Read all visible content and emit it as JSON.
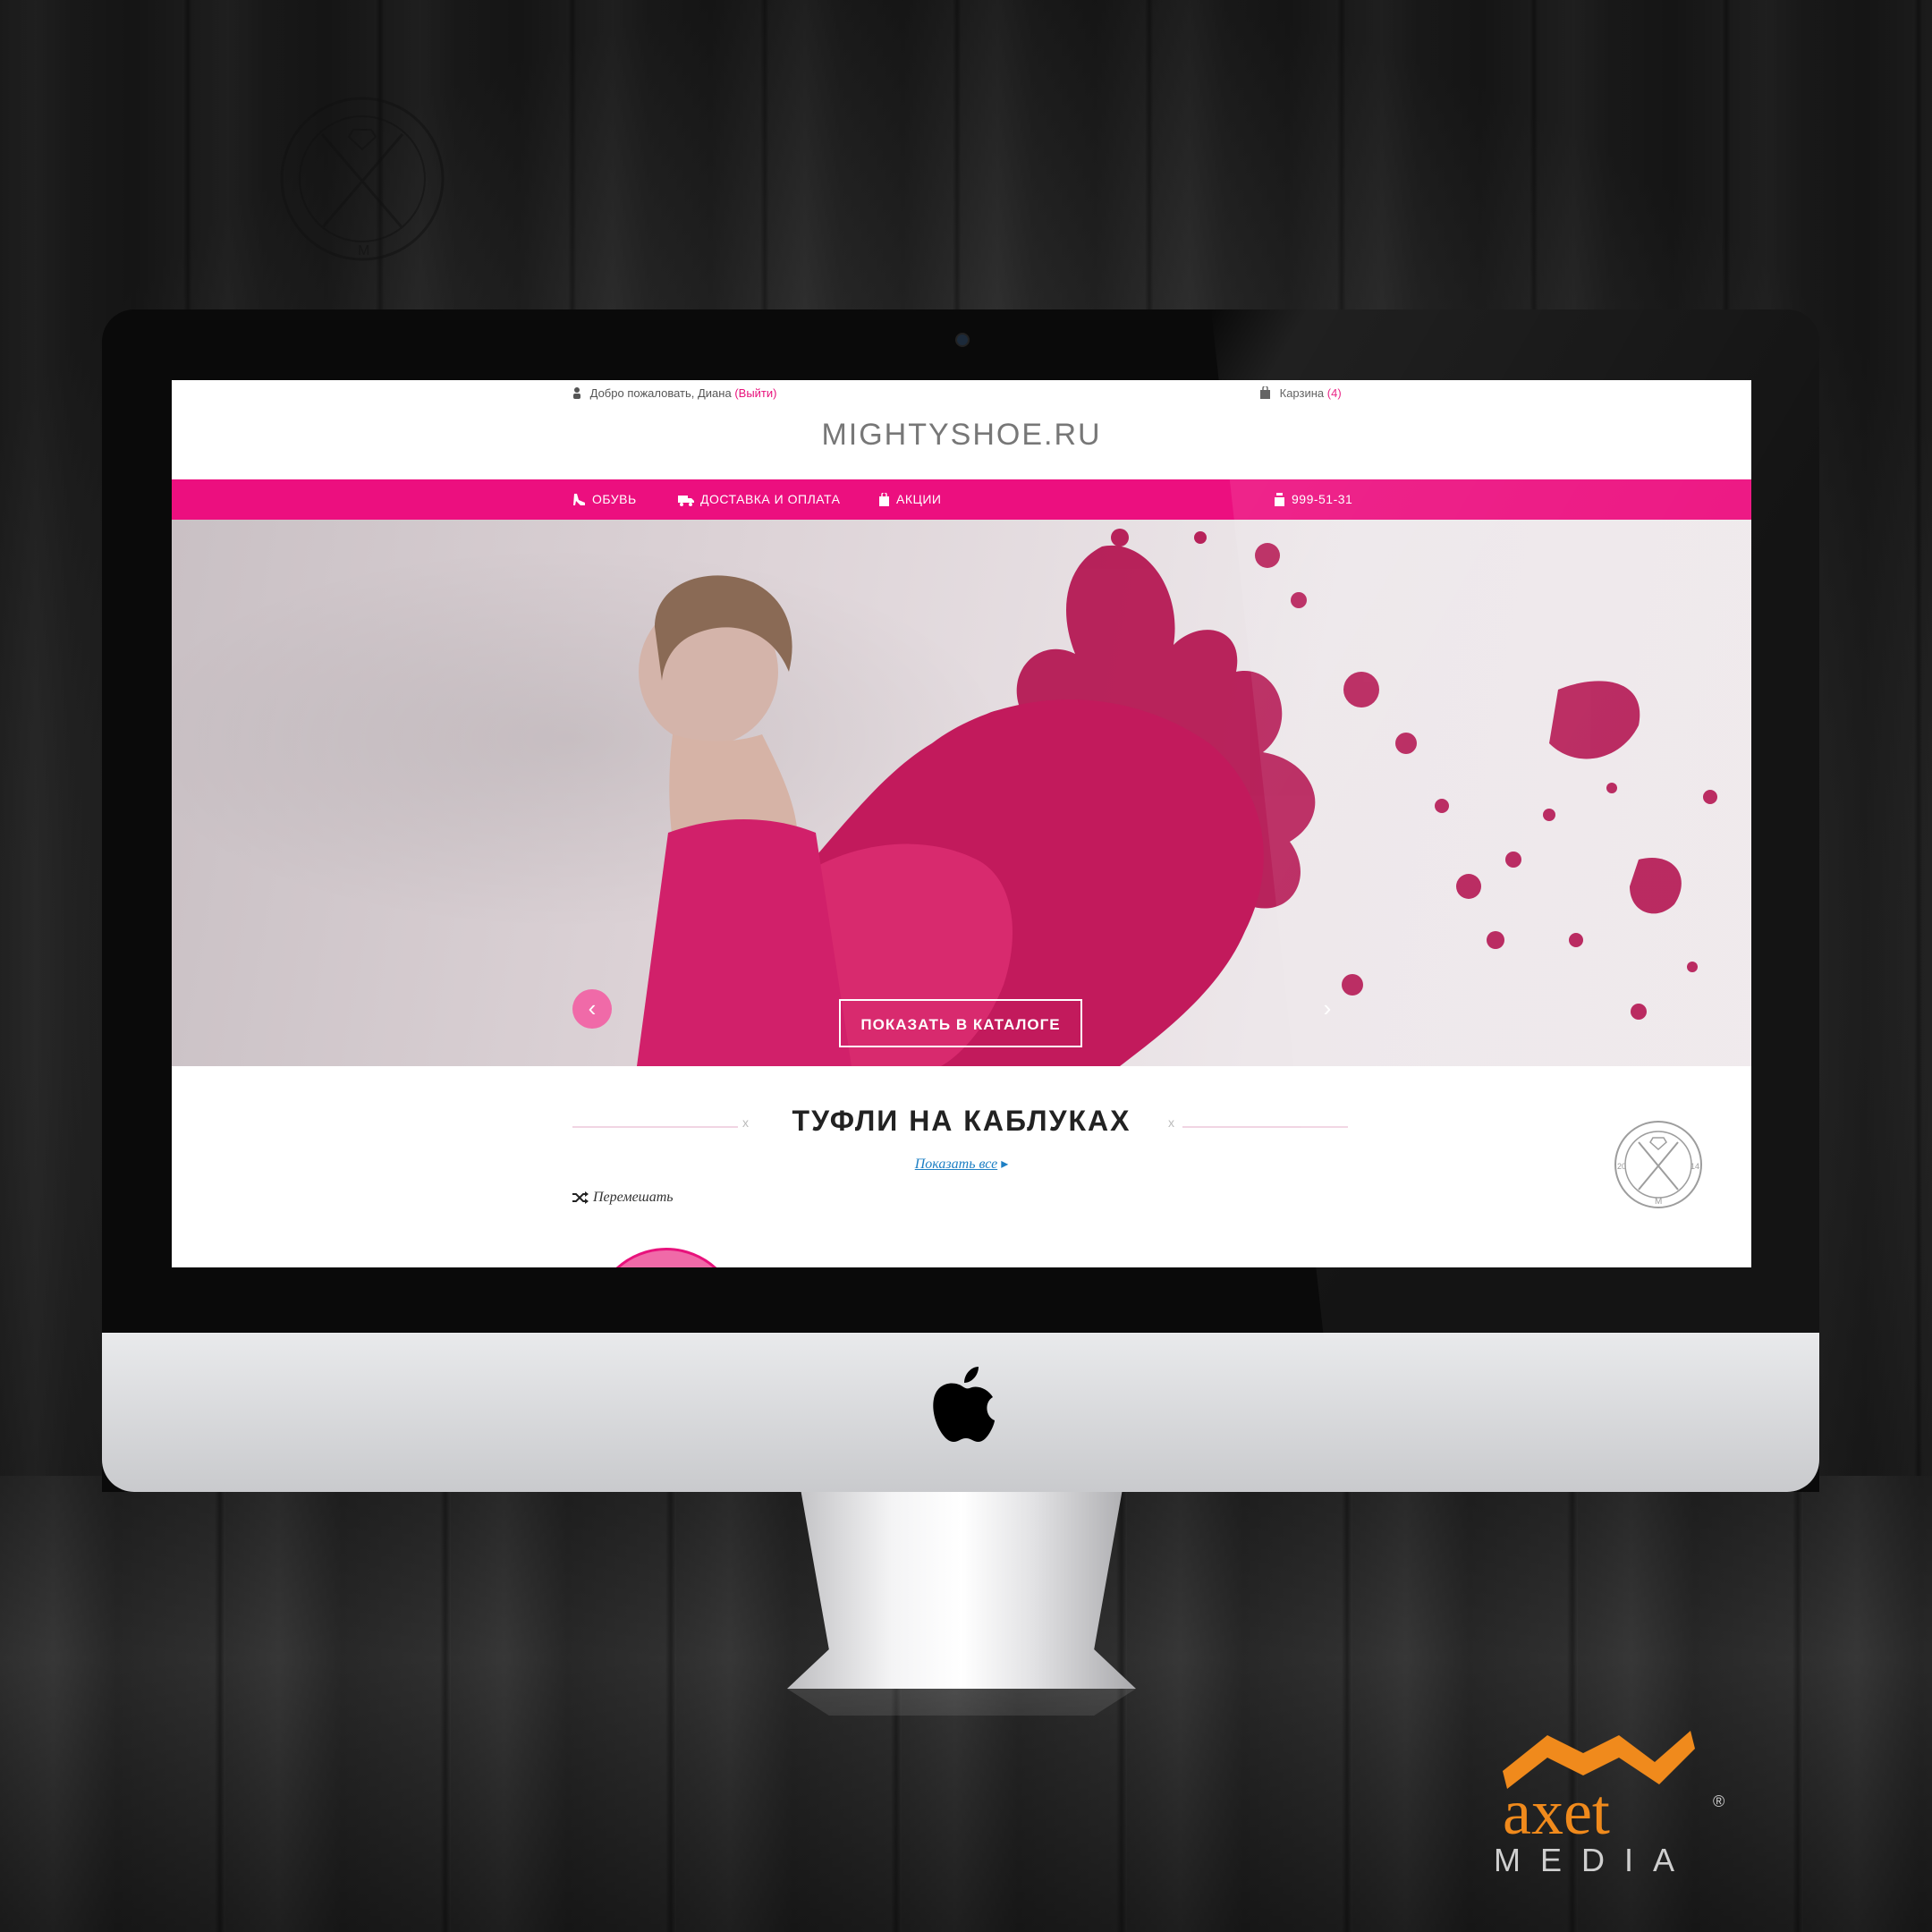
{
  "header": {
    "welcome_text": "Добро пожаловать, Диана",
    "logout_link": "(Выйти)",
    "cart_label": "Карзина",
    "cart_count": "(4)",
    "site_logo": "MIGHTYSHOE.RU"
  },
  "nav": {
    "items": [
      {
        "label": "ОБУВЬ",
        "icon": "shoe-icon"
      },
      {
        "label": "ДОСТАВКА И ОПЛАТА",
        "icon": "truck-icon"
      },
      {
        "label": "АКЦИИ",
        "icon": "bag-icon"
      }
    ],
    "phone": "999-51-31"
  },
  "hero": {
    "cta_label": "ПОКАЗАТЬ В КАТАЛОГЕ",
    "prev_arrow": "‹",
    "next_arrow": "›"
  },
  "section": {
    "title": "ТУФЛИ НА КАБЛУКАХ",
    "show_all": "Показать все",
    "show_all_marker": "▸",
    "shuffle": "Перемешать",
    "divider_mark": "x"
  },
  "badge": {
    "left_year": "20",
    "right_year": "14",
    "letter": "M"
  },
  "watermark": {
    "brand": "axet",
    "sub": "MEDIA",
    "reg": "®"
  },
  "colors": {
    "accent": "#ec0f7f",
    "link": "#1d7fc4",
    "brand_orange": "#f08a1c"
  }
}
